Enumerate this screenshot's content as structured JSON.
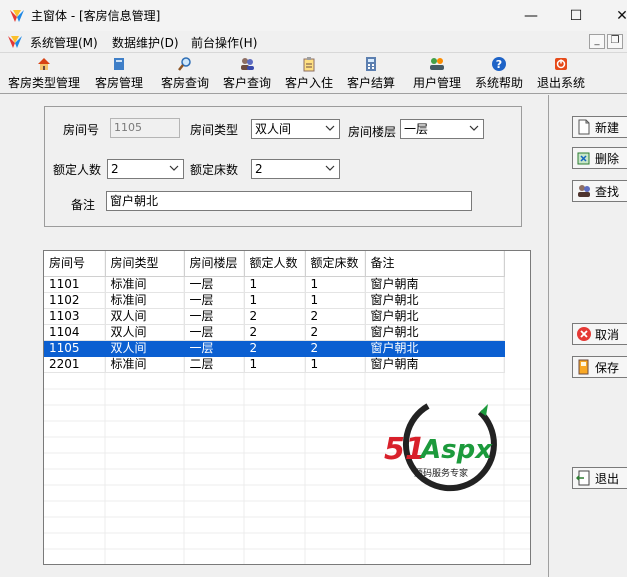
{
  "window": {
    "title": "主窗体 - [客房信息管理]",
    "minimize_glyph": "—",
    "maximize_glyph": "☐",
    "close_glyph": "✕"
  },
  "menu": {
    "items": [
      "系统管理(M)",
      "数据维护(D)",
      "前台操作(H)"
    ],
    "mdi_minimize": "_",
    "mdi_restore": "❐"
  },
  "toolbar": {
    "items": [
      {
        "label": "客房类型管理",
        "icon": "house-icon"
      },
      {
        "label": "客房管理",
        "icon": "book-icon"
      },
      {
        "label": "客房查询",
        "icon": "magnifier-icon"
      },
      {
        "label": "客户查询",
        "icon": "users-icon"
      },
      {
        "label": "客户入住",
        "icon": "clipboard-icon"
      },
      {
        "label": "客户结算",
        "icon": "calculator-icon"
      },
      {
        "label": "用户管理",
        "icon": "users-gear-icon"
      },
      {
        "label": "系统帮助",
        "icon": "help-icon"
      },
      {
        "label": "退出系统",
        "icon": "exit-icon"
      }
    ]
  },
  "form": {
    "room_no_label": "房间号",
    "room_no_value": "1105",
    "room_type_label": "房间类型",
    "room_type_value": "双人间",
    "floor_label": "房间楼层",
    "floor_value": "一层",
    "persons_label": "额定人数",
    "persons_value": "2",
    "beds_label": "额定床数",
    "beds_value": "2",
    "remark_label": "备注",
    "remark_value": "窗户朝北"
  },
  "grid": {
    "columns": [
      "房间号",
      "房间类型",
      "房间楼层",
      "额定人数",
      "额定床数",
      "备注"
    ],
    "rows": [
      [
        "1101",
        "标准间",
        "一层",
        "1",
        "1",
        "窗户朝南"
      ],
      [
        "1102",
        "标准间",
        "一层",
        "1",
        "1",
        "窗户朝北"
      ],
      [
        "1103",
        "双人间",
        "一层",
        "2",
        "2",
        "窗户朝北"
      ],
      [
        "1104",
        "双人间",
        "一层",
        "2",
        "2",
        "窗户朝北"
      ],
      [
        "1105",
        "双人间",
        "一层",
        "2",
        "2",
        "窗户朝北"
      ],
      [
        "2201",
        "标准间",
        "二层",
        "1",
        "1",
        "窗户朝南"
      ]
    ],
    "selected_index": 4
  },
  "watermark": {
    "brand_number": "51",
    "brand_text": "Aspx",
    "slogan": "源码服务专家"
  },
  "side_buttons": {
    "new": "新建",
    "delete": "删除",
    "find": "查找",
    "cancel": "取消",
    "save": "保存",
    "exit": "退出"
  },
  "colors": {
    "selection": "#0b5fd1",
    "watermark_red": "#d8202a",
    "watermark_green": "#1c9a3c"
  }
}
